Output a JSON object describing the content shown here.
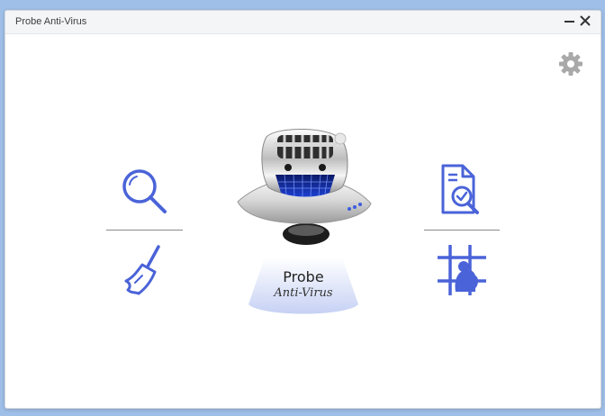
{
  "window": {
    "title": "Probe Anti-Virus"
  },
  "controls": {
    "minimize": "minimize-icon",
    "close": "close-icon",
    "settings": "gear-icon"
  },
  "features": [
    {
      "name": "scan",
      "icon": "search-icon"
    },
    {
      "name": "report",
      "icon": "document-check-icon"
    },
    {
      "name": "cleanup",
      "icon": "broom-icon"
    },
    {
      "name": "quarantine",
      "icon": "quarantine-grid-icon"
    }
  ],
  "brand": {
    "name": "Probe",
    "tagline": "Anti-Virus"
  },
  "colors": {
    "accent": "#4a63d8",
    "gear": "#a9a9a9",
    "beam": "#cfd8f5"
  }
}
